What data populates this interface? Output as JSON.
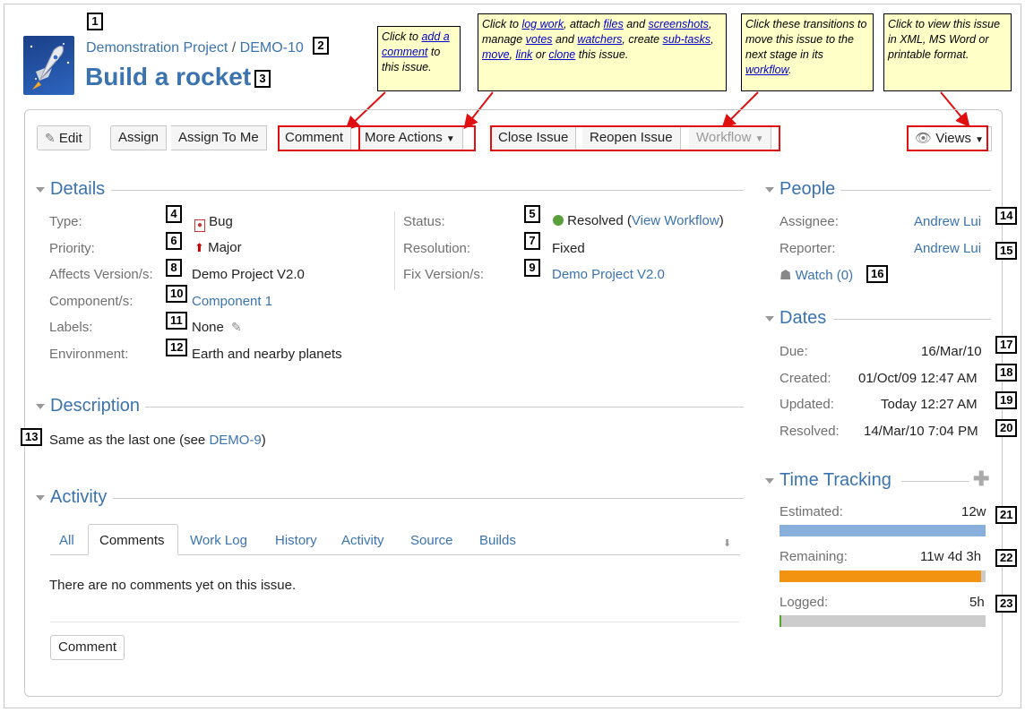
{
  "header": {
    "project": "Demonstration Project",
    "separator": "/",
    "issue_key": "DEMO-10",
    "title": "Build a rocket"
  },
  "annotations": {
    "n1": "1",
    "n2": "2",
    "n3": "3",
    "n4": "4",
    "n5": "5",
    "n6": "6",
    "n7": "7",
    "n8": "8",
    "n9": "9",
    "n10": "10",
    "n11": "11",
    "n12": "12",
    "n13": "13",
    "n14": "14",
    "n15": "15",
    "n16": "16",
    "n17": "17",
    "n18": "18",
    "n19": "19",
    "n20": "20",
    "n21": "21",
    "n22": "22",
    "n23": "23"
  },
  "notes": {
    "comment": {
      "t1": "Click to ",
      "l1": "add a comment",
      "t2": " to this issue."
    },
    "actions": {
      "t1": "Click to ",
      "l1": "log work",
      "t2": ", attach ",
      "l2": "files",
      "t3": " and ",
      "l3": "screenshots",
      "t4": ", manage ",
      "l4": "votes",
      "t5": " and ",
      "l5": "watchers",
      "t6": ", create ",
      "l6": "sub-tasks",
      "t7": ", ",
      "l7": "move",
      "t8": ", ",
      "l8": "link",
      "t9": " or ",
      "l9": "clone",
      "t10": " this issue."
    },
    "transitions": {
      "t1": "Click these transitions to move this issue to the next stage in its ",
      "l1": "workflow",
      "t2": "."
    },
    "views": {
      "t1": "Click to view this issue in XML, MS Word or printable format."
    }
  },
  "toolbar": {
    "edit": "Edit",
    "assign": "Assign",
    "assign_to_me": "Assign To Me",
    "comment": "Comment",
    "more_actions": "More Actions",
    "close_issue": "Close Issue",
    "reopen_issue": "Reopen Issue",
    "workflow": "Workflow",
    "views": "Views"
  },
  "details": {
    "title": "Details",
    "type_label": "Type:",
    "type": "Bug",
    "priority_label": "Priority:",
    "priority": "Major",
    "affects_label": "Affects Version/s:",
    "affects": "Demo Project V2.0",
    "component_label": "Component/s:",
    "component": "Component 1",
    "labels_label": "Labels:",
    "labels": "None",
    "environment_label": "Environment:",
    "environment": "Earth and nearby planets",
    "status_label": "Status:",
    "status": "Resolved",
    "status_open": "(",
    "view_workflow": "View Workflow",
    "status_close": ")",
    "resolution_label": "Resolution:",
    "resolution": "Fixed",
    "fix_label": "Fix Version/s:",
    "fix": "Demo Project V2.0"
  },
  "description": {
    "title": "Description",
    "text": "Same as the last one (see ",
    "link": "DEMO-9",
    "end": ")"
  },
  "activity": {
    "title": "Activity",
    "tabs": [
      "All",
      "Comments",
      "Work Log",
      "History",
      "Activity",
      "Source",
      "Builds"
    ],
    "empty": "There are no comments yet on this issue.",
    "comment_button": "Comment"
  },
  "people": {
    "title": "People",
    "assignee_label": "Assignee:",
    "assignee": "Andrew Lui",
    "reporter_label": "Reporter:",
    "reporter": "Andrew Lui",
    "watch": "Watch (0)"
  },
  "dates": {
    "title": "Dates",
    "due_label": "Due:",
    "due": "16/Mar/10",
    "created_label": "Created:",
    "created": "01/Oct/09 12:47 AM",
    "updated_label": "Updated:",
    "updated": "Today 12:27 AM",
    "resolved_label": "Resolved:",
    "resolved": "14/Mar/10 7:04 PM"
  },
  "time_tracking": {
    "title": "Time Tracking",
    "estimated_label": "Estimated:",
    "estimated": "12w",
    "estimated_fraction": 1.0,
    "remaining_label": "Remaining:",
    "remaining": "11w 4d 3h",
    "remaining_fraction": 0.98,
    "logged_label": "Logged:",
    "logged": "5h",
    "logged_fraction": 0.01
  },
  "colors": {
    "link": "#3b73af",
    "highlight": "#e01010",
    "estimated_bar": "#89b0dc",
    "remaining_bar": "#f29312",
    "logged_bar": "#51a825"
  }
}
